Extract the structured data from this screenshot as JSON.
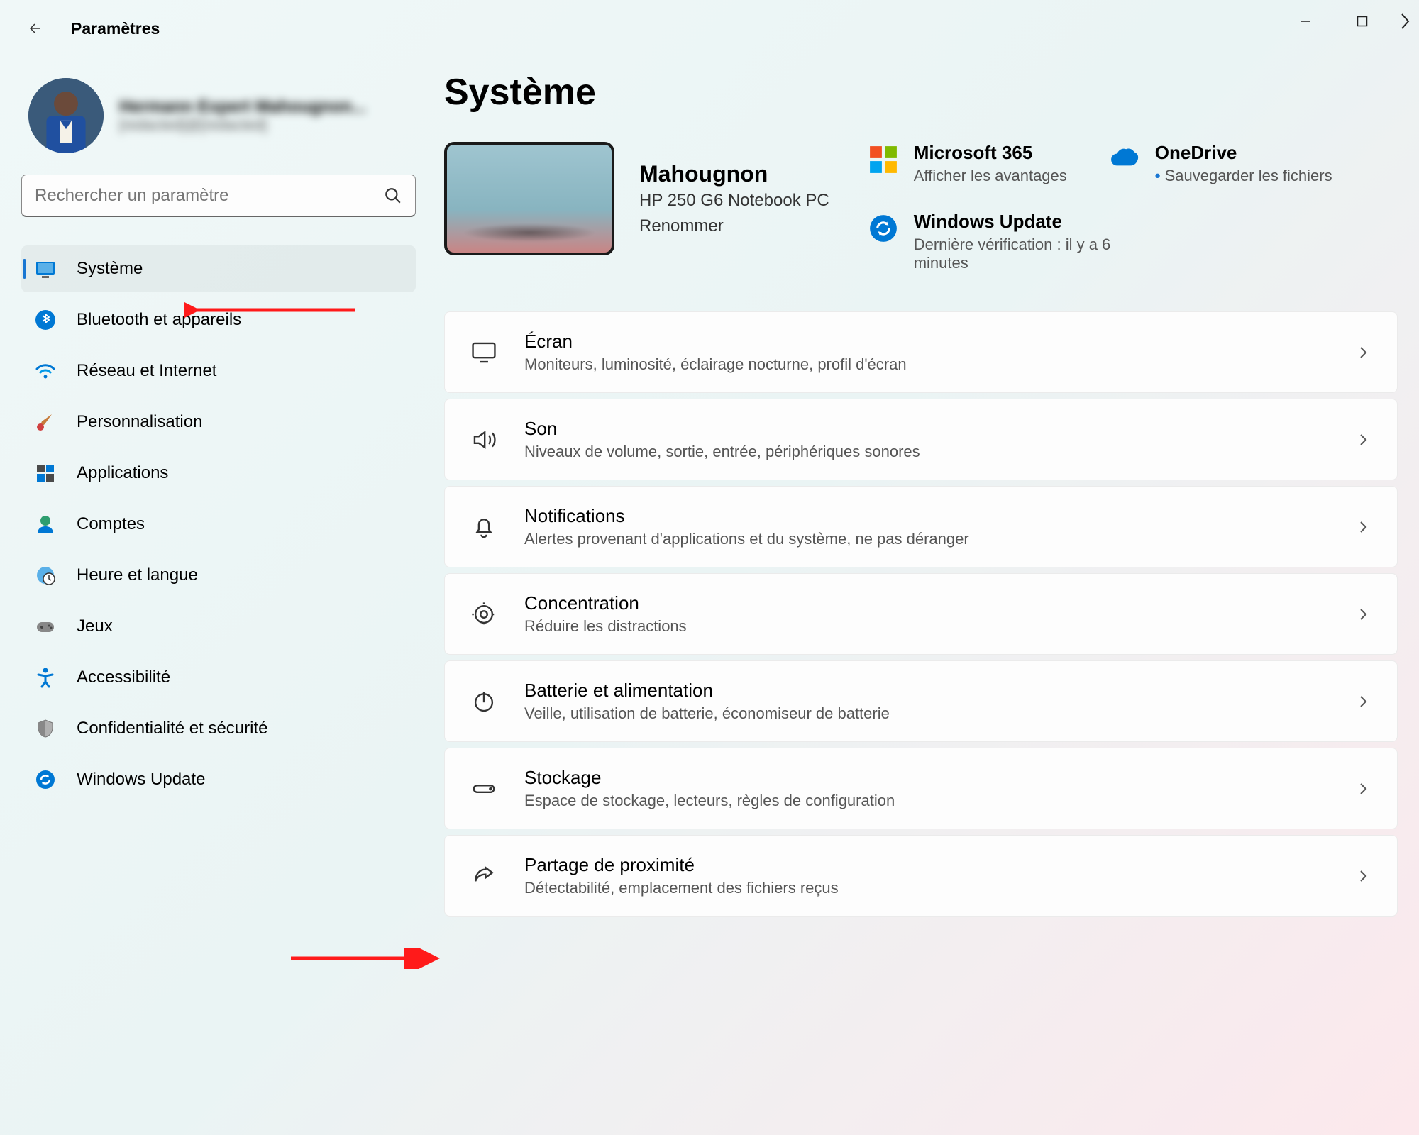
{
  "titlebar": {
    "title": "Paramètres"
  },
  "user": {
    "name": "Hermann Expert Mahougnon...",
    "email": "[redacted]@[redacted]"
  },
  "search": {
    "placeholder": "Rechercher un paramètre"
  },
  "nav": [
    {
      "label": "Système",
      "active": true
    },
    {
      "label": "Bluetooth et appareils"
    },
    {
      "label": "Réseau et Internet"
    },
    {
      "label": "Personnalisation"
    },
    {
      "label": "Applications"
    },
    {
      "label": "Comptes"
    },
    {
      "label": "Heure et langue"
    },
    {
      "label": "Jeux"
    },
    {
      "label": "Accessibilité"
    },
    {
      "label": "Confidentialité et sécurité"
    },
    {
      "label": "Windows Update"
    }
  ],
  "page": {
    "title": "Système"
  },
  "device": {
    "name": "Mahougnon",
    "model": "HP 250 G6 Notebook PC",
    "rename": "Renommer"
  },
  "tiles": {
    "ms365": {
      "title": "Microsoft 365",
      "sub": "Afficher les avantages"
    },
    "onedrive": {
      "title": "OneDrive",
      "sub": "Sauvegarder les fichiers"
    },
    "update": {
      "title": "Windows Update",
      "sub": "Dernière vérification : il y a 6 minutes"
    }
  },
  "cards": [
    {
      "title": "Écran",
      "sub": "Moniteurs, luminosité, éclairage nocturne, profil d'écran"
    },
    {
      "title": "Son",
      "sub": "Niveaux de volume, sortie, entrée, périphériques sonores"
    },
    {
      "title": "Notifications",
      "sub": "Alertes provenant d'applications et du système, ne pas déranger"
    },
    {
      "title": "Concentration",
      "sub": "Réduire les distractions"
    },
    {
      "title": "Batterie et alimentation",
      "sub": "Veille, utilisation de batterie, économiseur de batterie"
    },
    {
      "title": "Stockage",
      "sub": "Espace de stockage, lecteurs, règles de configuration"
    },
    {
      "title": "Partage de proximité",
      "sub": "Détectabilité, emplacement des fichiers reçus"
    }
  ]
}
